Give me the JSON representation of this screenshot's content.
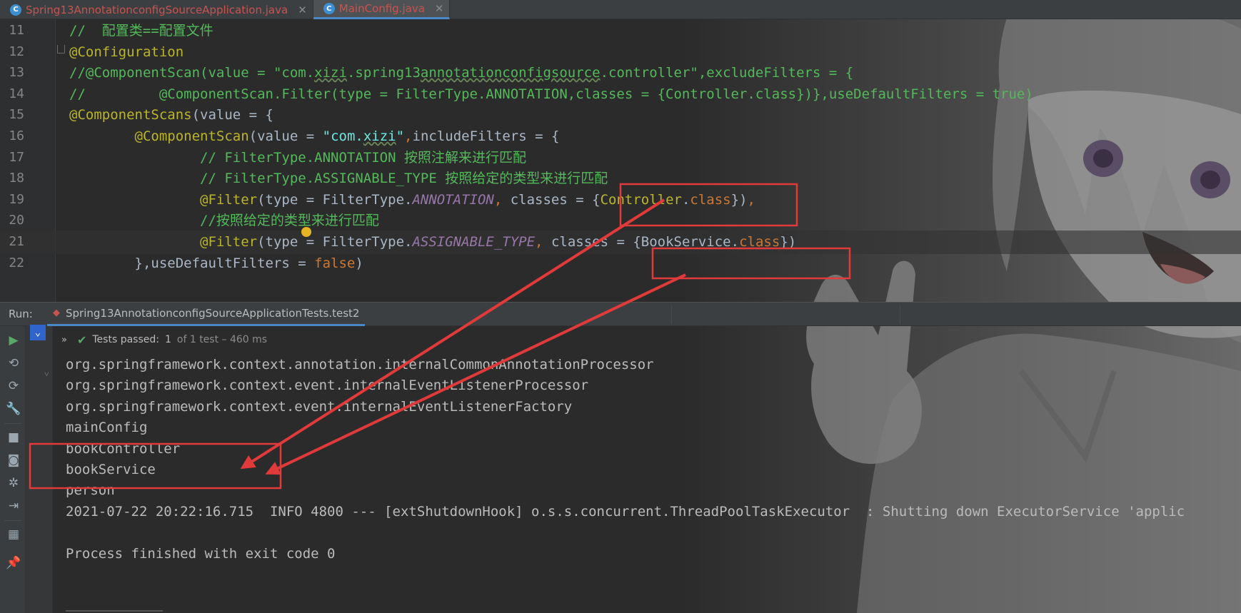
{
  "tabs": [
    {
      "label": "Spring13AnnotationconfigSourceApplication.java",
      "active": false
    },
    {
      "label": "MainConfig.java",
      "active": true
    }
  ],
  "editor": {
    "lines": [
      {
        "num": "11",
        "parts": [
          {
            "t": "//  配置类==配置文件",
            "c": "comment"
          }
        ]
      },
      {
        "num": "12",
        "parts": [
          {
            "t": "@Configuration",
            "c": "annot"
          }
        ]
      },
      {
        "num": "13",
        "parts": [
          {
            "t": "//@ComponentScan(value = \"com.",
            "c": "comment"
          },
          {
            "t": "xizi",
            "c": "comment-u"
          },
          {
            "t": ".spring13",
            "c": "comment"
          },
          {
            "t": "annotationconfigsource",
            "c": "comment-u"
          },
          {
            "t": ".controller\",excludeFilters = {",
            "c": "comment"
          }
        ]
      },
      {
        "num": "14",
        "parts": [
          {
            "t": "//         @ComponentScan.Filter(type = FilterType.ANNOTATION,classes = {Controller.class})},useDefaultFilters = true)",
            "c": "comment"
          }
        ]
      },
      {
        "num": "15",
        "parts": [
          {
            "t": "@ComponentScans",
            "c": "annot"
          },
          {
            "t": "(value = {",
            "c": "plain"
          }
        ]
      },
      {
        "num": "16",
        "parts": [
          {
            "t": "        ",
            "c": "plain"
          },
          {
            "t": "@ComponentScan",
            "c": "annot"
          },
          {
            "t": "(value = ",
            "c": "plain"
          },
          {
            "t": "\"com.",
            "c": "str"
          },
          {
            "t": "xizi",
            "c": "str-u"
          },
          {
            "t": "\"",
            "c": "str"
          },
          {
            "t": ",",
            "c": "kw"
          },
          {
            "t": "includeFilters = {",
            "c": "plain"
          }
        ]
      },
      {
        "num": "17",
        "parts": [
          {
            "t": "                // FilterType.ANNOTATION 按照注解来进行匹配",
            "c": "comment"
          }
        ]
      },
      {
        "num": "18",
        "parts": [
          {
            "t": "                // FilterType.ASSIGNABLE_TYPE 按照给定的类型来进行匹配",
            "c": "comment"
          }
        ]
      },
      {
        "num": "19",
        "parts": [
          {
            "t": "                ",
            "c": "plain"
          },
          {
            "t": "@Filter",
            "c": "annot"
          },
          {
            "t": "(type = FilterType.",
            "c": "plain"
          },
          {
            "t": "ANNOTATION",
            "c": "const"
          },
          {
            "t": ", ",
            "c": "kw"
          },
          {
            "t": "classes = {",
            "c": "plain"
          },
          {
            "t": "Controller",
            "c": "annot"
          },
          {
            "t": ".",
            "c": "plain"
          },
          {
            "t": "class",
            "c": "kw"
          },
          {
            "t": "})",
            "c": "plain"
          },
          {
            "t": ",",
            "c": "kw"
          }
        ]
      },
      {
        "num": "20",
        "parts": [
          {
            "t": "                //按照给定的类型来进行匹配",
            "c": "comment"
          }
        ]
      },
      {
        "num": "21",
        "parts": [
          {
            "t": "                ",
            "c": "plain"
          },
          {
            "t": "@Filter",
            "c": "annot"
          },
          {
            "t": "(type = FilterType.",
            "c": "plain"
          },
          {
            "t": "ASSIGNABLE_TYPE",
            "c": "const"
          },
          {
            "t": ", ",
            "c": "kw"
          },
          {
            "t": "classes = {",
            "c": "plain"
          },
          {
            "t": "BookService",
            "c": "plain"
          },
          {
            "t": ".",
            "c": "plain"
          },
          {
            "t": "class",
            "c": "kw"
          },
          {
            "t": "})",
            "c": "plain"
          }
        ],
        "current": true
      },
      {
        "num": "22",
        "parts": [
          {
            "t": "        },",
            "c": "plain"
          },
          {
            "t": "useDefaultFilters = ",
            "c": "plain"
          },
          {
            "t": "false",
            "c": "kw"
          },
          {
            "t": ")",
            "c": "plain"
          }
        ]
      }
    ]
  },
  "run": {
    "label": "Run:",
    "tab_label": "Spring13AnnotationconfigSourceApplicationTests.test2",
    "status_passed": "Tests passed:",
    "status_count": "1",
    "status_detail": "of 1 test – 460 ms",
    "console_lines": [
      "org.springframework.context.annotation.internalCommonAnnotationProcessor",
      "org.springframework.context.event.internalEventListenerProcessor",
      "org.springframework.context.event.internalEventListenerFactory",
      "mainConfig",
      "bookController",
      "bookService",
      "person",
      "2021-07-22 20:22:16.715  INFO 4800 --- [extShutdownHook] o.s.s.concurrent.ThreadPoolTaskExecutor  : Shutting down ExecutorService 'applic",
      "",
      "Process finished with exit code 0"
    ]
  },
  "colors": {
    "comment": "#53b95a",
    "annotation": "#bbb529",
    "string": "#6ae8e1",
    "constant": "#9876aa",
    "keyword": "#cc7832",
    "highlight_box": "#e03a3a"
  }
}
